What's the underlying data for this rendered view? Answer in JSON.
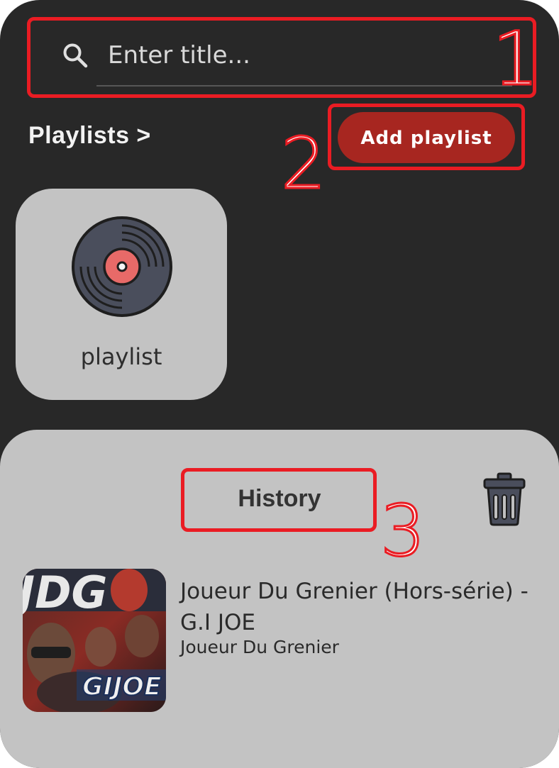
{
  "search": {
    "placeholder": "Enter title..."
  },
  "playlists": {
    "title": "Playlists >",
    "add_button": "Add playlist",
    "items": [
      {
        "label": "playlist"
      }
    ]
  },
  "history": {
    "title": "History",
    "items": [
      {
        "title": "Joueur Du Grenier (Hors-série) - G.I JOE",
        "artist": "Joueur Du Grenier",
        "thumb_text": "GIJOE"
      }
    ]
  },
  "annotations": [
    "1",
    "2",
    "3"
  ],
  "colors": {
    "background": "#282828",
    "accent": "#a72620",
    "panel": "#c3c3c3",
    "annotation": "#ea1c23"
  }
}
